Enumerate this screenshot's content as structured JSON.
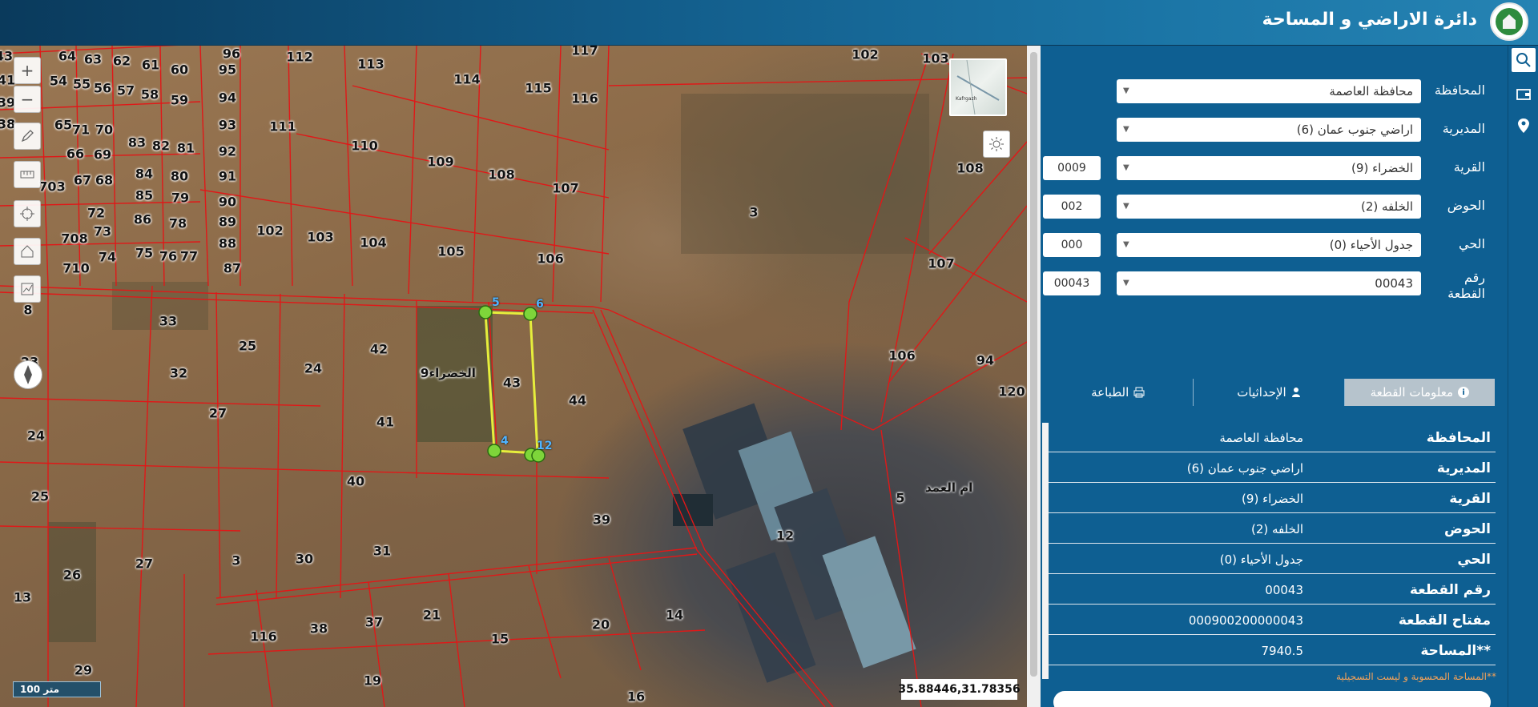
{
  "header": {
    "title": "دائرة الاراضي و المساحة"
  },
  "map": {
    "controls": [
      "zoom-in",
      "zoom-out",
      "draw",
      "measure",
      "locate",
      "home",
      "print"
    ],
    "scale_label": "100 متر",
    "coordinates": "35.88446,31.78356",
    "overview_label": "Kafrgazh",
    "place_labels": [
      {
        "id": "p1",
        "text": "الخضراء9"
      },
      {
        "id": "p2",
        "text": "ام العمد"
      }
    ],
    "selected_parcel": "43",
    "vertex_labels": [
      "5",
      "6",
      "4",
      "12"
    ],
    "parcel_numbers": [
      "43",
      "64",
      "63",
      "62",
      "61",
      "60",
      "96",
      "95",
      "94",
      "93",
      "92",
      "91",
      "90",
      "89",
      "88",
      "87",
      "112",
      "113",
      "114",
      "115",
      "116",
      "117",
      "102",
      "103",
      "41",
      "39",
      "38",
      "54",
      "55",
      "56",
      "57",
      "58",
      "59",
      "65",
      "71",
      "70",
      "83",
      "82",
      "81",
      "66",
      "69",
      "84",
      "80",
      "703",
      "67",
      "68",
      "85",
      "79",
      "72",
      "86",
      "78",
      "73",
      "708",
      "75",
      "76",
      "77",
      "74",
      "710",
      "111",
      "110",
      "109",
      "108",
      "107",
      "102",
      "103",
      "104",
      "105",
      "106",
      "3",
      "108",
      "107",
      "106",
      "94",
      "120",
      "33",
      "25",
      "23",
      "32",
      "42",
      "24",
      "9",
      "43",
      "44",
      "27",
      "41",
      "40",
      "24",
      "25",
      "26",
      "27",
      "3",
      "30",
      "31",
      "39",
      "12",
      "5",
      "116",
      "38",
      "37",
      "21",
      "20",
      "15",
      "14",
      "13",
      "29",
      "19",
      "16",
      "8"
    ]
  },
  "panel": {
    "fields": [
      {
        "label": "المحافظة",
        "value": "محافظة العاصمة",
        "code": ""
      },
      {
        "label": "المديرية",
        "value": "اراضي جنوب عمان (6)",
        "code": ""
      },
      {
        "label": "القرية",
        "value": "الخضراء (9)",
        "code": "0009"
      },
      {
        "label": "الحوض",
        "value": "الخلفه (2)",
        "code": "002"
      },
      {
        "label": "الحي",
        "value": "جدول الأحياء (0)",
        "code": "000"
      },
      {
        "label": "رقم القطعة",
        "value": "00043",
        "code": "00043"
      }
    ],
    "tabs": [
      {
        "label": "معلومات القطعة",
        "icon": "info-icon"
      },
      {
        "label": "الإحداثيات",
        "icon": "person-pin-icon"
      },
      {
        "label": "الطباعة",
        "icon": "printer-icon"
      }
    ],
    "info": [
      {
        "label": "المحافظة",
        "value": "محافظة العاصمة"
      },
      {
        "label": "المديرية",
        "value": "اراضي جنوب عمان (6)"
      },
      {
        "label": "القرية",
        "value": "الخضراء (9)"
      },
      {
        "label": "الحوض",
        "value": "الخلفه (2)"
      },
      {
        "label": "الحي",
        "value": "جدول الأحياء (0)"
      },
      {
        "label": "رقم القطعة",
        "value": "00043"
      },
      {
        "label": "مفتاح القطعة",
        "value": "000900200000043"
      },
      {
        "label": "**المساحة",
        "value": "7940.5"
      }
    ],
    "note": "**المساحة المحسوبة و ليست التسجيلية"
  },
  "toolbar": [
    "search-icon",
    "wallet-icon",
    "location-pin-icon"
  ]
}
